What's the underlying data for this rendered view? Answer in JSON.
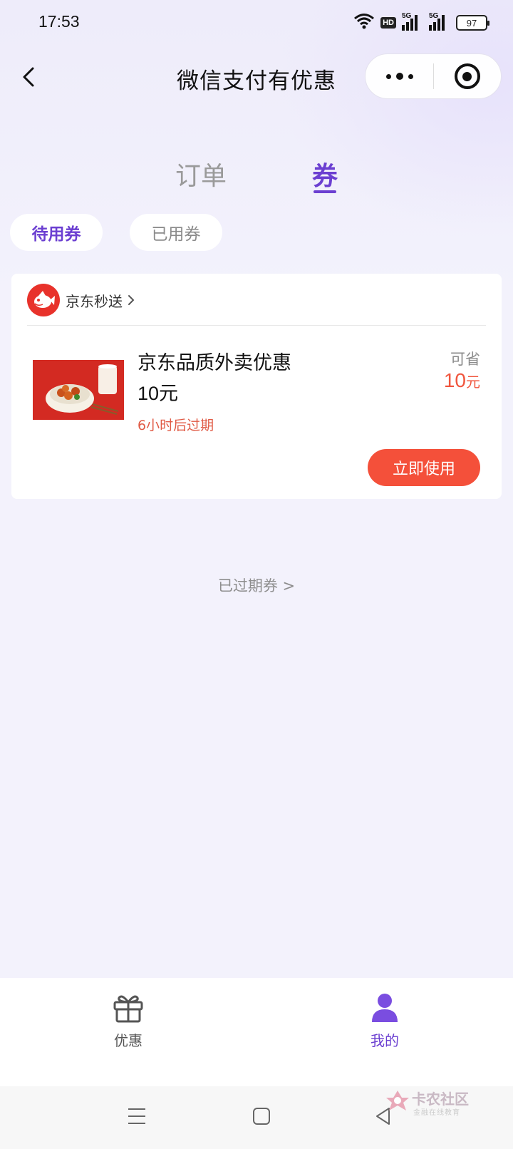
{
  "status_bar": {
    "time": "17:53",
    "hd_label": "HD",
    "signal_1_label": "5G",
    "signal_2_label": "5G",
    "battery": "97"
  },
  "nav": {
    "title": "微信支付有优惠",
    "icons": {
      "back": "chevron-left-icon",
      "more": "more-dots-icon",
      "close": "close-miniprogram-icon"
    }
  },
  "tabs": {
    "orders": "订单",
    "coupons": "券",
    "active": "coupons"
  },
  "sub_tabs": {
    "unused": "待用券",
    "used": "已用券",
    "active": "unused"
  },
  "coupon": {
    "merchant": "京东秒送",
    "title": "京东品质外卖优惠",
    "value": "10元",
    "expire": "6小时后过期",
    "save_label": "可省",
    "save_amount": "10",
    "save_unit": "元",
    "use_button": "立即使用"
  },
  "expired_link": "已过期券 >",
  "tabbar": {
    "offers": "优惠",
    "mine": "我的",
    "active": "mine"
  },
  "watermark": {
    "title": "卡农社区",
    "subtitle": "金融在线教育"
  },
  "colors": {
    "accent": "#6b3fd1",
    "coupon_red": "#f4503a",
    "background": "#f3f2fc"
  }
}
